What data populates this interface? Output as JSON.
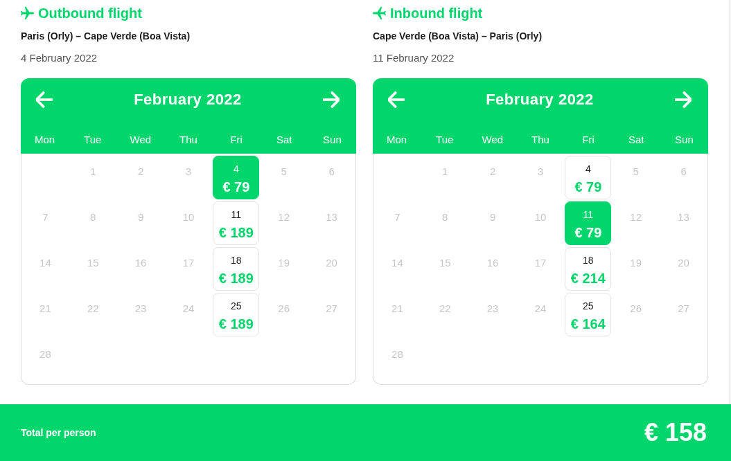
{
  "flights": [
    {
      "kind": "outbound",
      "title": "Outbound flight",
      "route": "Paris (Orly) – Cape Verde (Boa Vista)",
      "date": "4 February 2022",
      "calendar": {
        "month": "February 2022",
        "weekdays": [
          "Mon",
          "Tue",
          "Wed",
          "Thu",
          "Fri",
          "Sat",
          "Sun"
        ],
        "weeks": [
          [
            {
              "day": "1",
              "disabled": true,
              "selected": false
            },
            {
              "day": "2",
              "disabled": true,
              "selected": false
            },
            {
              "day": "3",
              "disabled": true,
              "selected": false
            },
            {
              "day": "4",
              "price": "€ 79",
              "disabled": false,
              "selected": true
            },
            {
              "day": "5",
              "disabled": true,
              "selected": false
            },
            {
              "day": "6",
              "disabled": true,
              "selected": false
            }
          ],
          [
            {
              "day": "7",
              "disabled": true,
              "selected": false
            },
            {
              "day": "8",
              "disabled": true,
              "selected": false
            },
            {
              "day": "9",
              "disabled": true,
              "selected": false
            },
            {
              "day": "10",
              "disabled": true,
              "selected": false
            },
            {
              "day": "11",
              "price": "€ 189",
              "disabled": false,
              "selected": false
            },
            {
              "day": "12",
              "disabled": true,
              "selected": false
            },
            {
              "day": "13",
              "disabled": true,
              "selected": false
            }
          ],
          [
            {
              "day": "14",
              "disabled": true,
              "selected": false
            },
            {
              "day": "15",
              "disabled": true,
              "selected": false
            },
            {
              "day": "16",
              "disabled": true,
              "selected": false
            },
            {
              "day": "17",
              "disabled": true,
              "selected": false
            },
            {
              "day": "18",
              "price": "€ 189",
              "disabled": false,
              "selected": false
            },
            {
              "day": "19",
              "disabled": true,
              "selected": false
            },
            {
              "day": "20",
              "disabled": true,
              "selected": false
            }
          ],
          [
            {
              "day": "21",
              "disabled": true,
              "selected": false
            },
            {
              "day": "22",
              "disabled": true,
              "selected": false
            },
            {
              "day": "23",
              "disabled": true,
              "selected": false
            },
            {
              "day": "24",
              "disabled": true,
              "selected": false
            },
            {
              "day": "25",
              "price": "€ 189",
              "disabled": false,
              "selected": false
            },
            {
              "day": "26",
              "disabled": true,
              "selected": false
            },
            {
              "day": "27",
              "disabled": true,
              "selected": false
            }
          ],
          [
            {
              "day": "28",
              "disabled": true,
              "selected": false
            }
          ]
        ]
      }
    },
    {
      "kind": "inbound",
      "title": "Inbound flight",
      "route": "Cape Verde (Boa Vista) – Paris (Orly)",
      "date": "11 February 2022",
      "calendar": {
        "month": "February 2022",
        "weekdays": [
          "Mon",
          "Tue",
          "Wed",
          "Thu",
          "Fri",
          "Sat",
          "Sun"
        ],
        "weeks": [
          [
            {
              "day": "1",
              "disabled": true,
              "selected": false
            },
            {
              "day": "2",
              "disabled": true,
              "selected": false
            },
            {
              "day": "3",
              "disabled": true,
              "selected": false
            },
            {
              "day": "4",
              "price": "€ 79",
              "disabled": false,
              "selected": false
            },
            {
              "day": "5",
              "disabled": true,
              "selected": false
            },
            {
              "day": "6",
              "disabled": true,
              "selected": false
            }
          ],
          [
            {
              "day": "7",
              "disabled": true,
              "selected": false
            },
            {
              "day": "8",
              "disabled": true,
              "selected": false
            },
            {
              "day": "9",
              "disabled": true,
              "selected": false
            },
            {
              "day": "10",
              "disabled": true,
              "selected": false
            },
            {
              "day": "11",
              "price": "€ 79",
              "disabled": false,
              "selected": true
            },
            {
              "day": "12",
              "disabled": true,
              "selected": false
            },
            {
              "day": "13",
              "disabled": true,
              "selected": false
            }
          ],
          [
            {
              "day": "14",
              "disabled": true,
              "selected": false
            },
            {
              "day": "15",
              "disabled": true,
              "selected": false
            },
            {
              "day": "16",
              "disabled": true,
              "selected": false
            },
            {
              "day": "17",
              "disabled": true,
              "selected": false
            },
            {
              "day": "18",
              "price": "€ 214",
              "disabled": false,
              "selected": false
            },
            {
              "day": "19",
              "disabled": true,
              "selected": false
            },
            {
              "day": "20",
              "disabled": true,
              "selected": false
            }
          ],
          [
            {
              "day": "21",
              "disabled": true,
              "selected": false
            },
            {
              "day": "22",
              "disabled": true,
              "selected": false
            },
            {
              "day": "23",
              "disabled": true,
              "selected": false
            },
            {
              "day": "24",
              "disabled": true,
              "selected": false
            },
            {
              "day": "25",
              "price": "€ 164",
              "disabled": false,
              "selected": false
            },
            {
              "day": "26",
              "disabled": true,
              "selected": false
            },
            {
              "day": "27",
              "disabled": true,
              "selected": false
            }
          ],
          [
            {
              "day": "28",
              "disabled": true,
              "selected": false
            }
          ]
        ]
      }
    }
  ],
  "total": {
    "label": "Total per person",
    "price": "€ 158"
  }
}
